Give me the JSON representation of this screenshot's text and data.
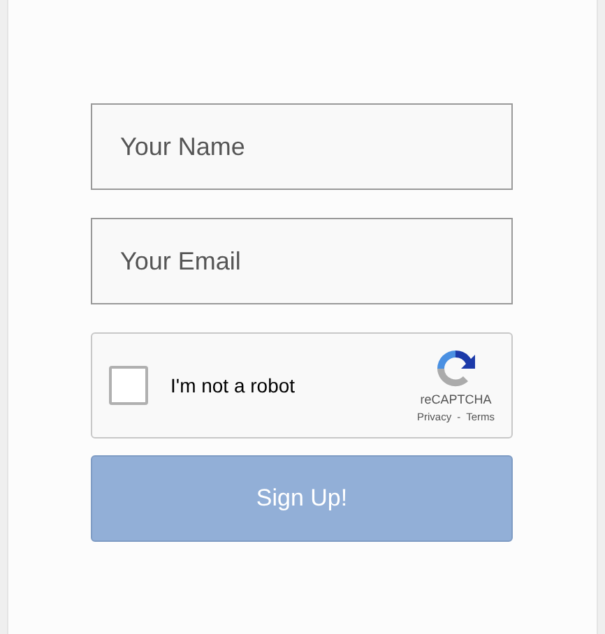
{
  "fields": [
    {
      "placeholder": "Your Name"
    },
    {
      "placeholder": "Your Email"
    }
  ],
  "captcha": {
    "label": "I'm not a robot",
    "checked": false,
    "brand": "reCAPTCHA",
    "privacy": "Privacy",
    "separator": "-",
    "terms": "Terms"
  },
  "button": {
    "label": "Sign Up!"
  }
}
